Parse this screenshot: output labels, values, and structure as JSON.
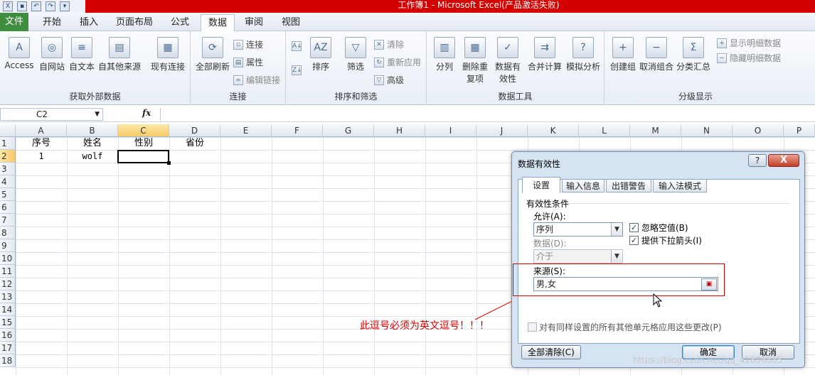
{
  "window": {
    "title": "工作簿1 - Microsoft Excel(产品激活失败)"
  },
  "qat": {
    "icons": [
      "excel-logo-icon",
      "save-icon",
      "undo-icon",
      "redo-icon",
      "customize-icon"
    ]
  },
  "tabs": [
    {
      "label": "文件"
    },
    {
      "label": "开始"
    },
    {
      "label": "插入"
    },
    {
      "label": "页面布局"
    },
    {
      "label": "公式"
    },
    {
      "label": "数据",
      "active": true
    },
    {
      "label": "审阅"
    },
    {
      "label": "视图"
    }
  ],
  "ribbon": {
    "groups": {
      "external": {
        "label": "获取外部数据",
        "buttons": [
          "Access",
          "自网站",
          "自文本",
          "自其他来源",
          "现有连接"
        ]
      },
      "connections": {
        "label": "连接",
        "refresh": "全部刷新",
        "items": [
          "连接",
          "属性",
          "编辑链接"
        ]
      },
      "sort": {
        "label": "排序和筛选",
        "sort": "排序",
        "filter": "筛选",
        "items": [
          "清除",
          "重新应用",
          "高级"
        ]
      },
      "tools": {
        "label": "数据工具",
        "buttons": [
          "分列",
          "删除重复项",
          "数据有效性",
          "合并计算",
          "模拟分析"
        ]
      },
      "outline": {
        "label": "分级显示",
        "buttons": [
          "创建组",
          "取消组合",
          "分类汇总"
        ],
        "items": [
          "显示明细数据",
          "隐藏明细数据"
        ]
      }
    }
  },
  "formula_bar": {
    "name_box": "C2",
    "fx": "fx",
    "formula": ""
  },
  "sheet": {
    "columns": [
      "A",
      "B",
      "C",
      "D",
      "E",
      "F",
      "G",
      "H",
      "I",
      "J",
      "K",
      "L",
      "M",
      "N",
      "O",
      "P"
    ],
    "rows": [
      "1",
      "2",
      "3",
      "4",
      "5",
      "6",
      "7",
      "8",
      "9",
      "10",
      "11",
      "12",
      "13",
      "14",
      "15",
      "16",
      "17",
      "18"
    ],
    "cells": {
      "A1": "序号",
      "B1": "姓名",
      "C1": "性别",
      "D1": "省份",
      "A2": "1",
      "B2": "wolf"
    },
    "selected_cell": "C2"
  },
  "annotation": {
    "text": "此逗号必须为英文逗号！！！",
    "color": "#d00000"
  },
  "dialog": {
    "title": "数据有效性",
    "help": "?",
    "close": "X",
    "tabs": [
      "设置",
      "输入信息",
      "出错警告",
      "输入法模式"
    ],
    "active_tab": "设置",
    "section": "有效性条件",
    "allow_label": "允许(A):",
    "allow_value": "序列",
    "data_label": "数据(D):",
    "data_value": "介于",
    "ignore_blank": {
      "label": "忽略空值(B)",
      "checked": true
    },
    "dropdown": {
      "label": "提供下拉箭头(I)",
      "checked": true
    },
    "source_label": "来源(S):",
    "source_value": "男,女",
    "apply_all": {
      "label": "对有同样设置的所有其他单元格应用这些更改(P)",
      "checked": false
    },
    "clear_all": "全部清除(C)",
    "ok": "确定",
    "cancel": "取消"
  },
  "watermark": "https://blog.csdn.net/qq_41606665"
}
